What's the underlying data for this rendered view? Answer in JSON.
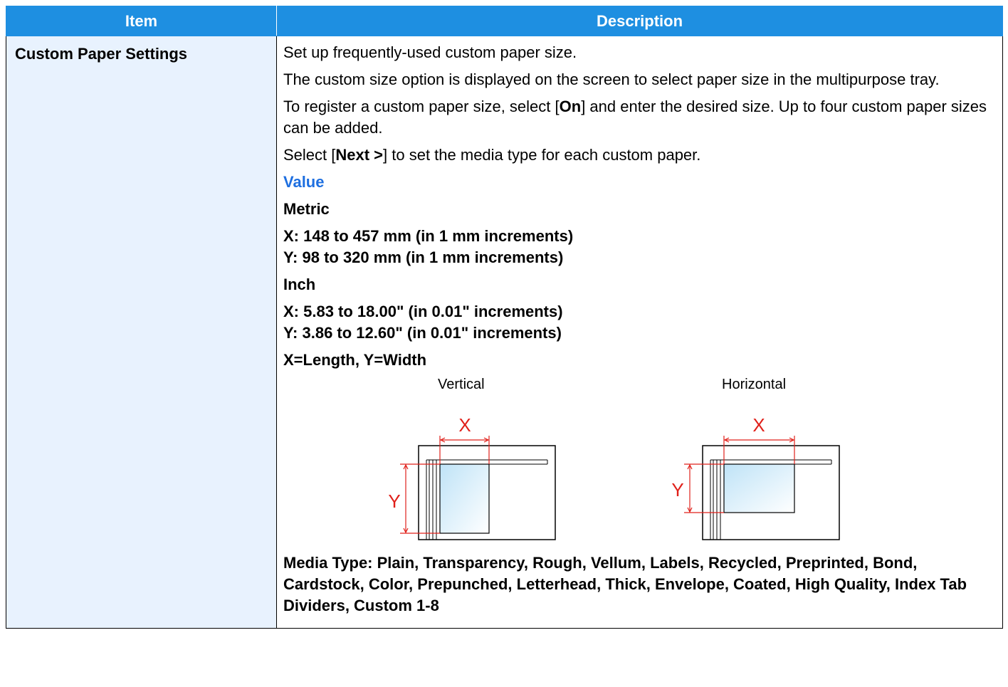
{
  "table": {
    "headers": {
      "item": "Item",
      "description": "Description"
    },
    "row": {
      "item": "Custom Paper Settings",
      "paragraphs": [
        "Set up frequently-used custom paper size.",
        "The custom size option is displayed on the screen to select paper size in the multipurpose tray."
      ],
      "register": {
        "before": "To register a custom paper size, select [",
        "bold": "On",
        "after": "] and enter the desired size. Up to four custom paper sizes can be added."
      },
      "next": {
        "before": "Select [",
        "bold": "Next >",
        "after": "] to set the media type for each custom paper."
      },
      "value_heading": "Value",
      "metric_heading": "Metric",
      "metric_x": "X: 148 to 457 mm (in 1 mm increments)",
      "metric_y": "Y: 98 to 320 mm (in 1 mm increments)",
      "inch_heading": "Inch",
      "inch_x": "X: 5.83 to 18.00\" (in 0.01\" increments)",
      "inch_y": "Y: 3.86 to 12.60\" (in 0.01\" increments)",
      "xy_note": "X=Length, Y=Width",
      "figures": {
        "vertical_label": "Vertical",
        "horizontal_label": "Horizontal",
        "x_marker": "X",
        "y_marker": "Y",
        "dimension_color": "#e0201a"
      },
      "media_type": "Media Type: Plain, Transparency, Rough, Vellum, Labels, Recycled, Preprinted, Bond, Cardstock, Color, Prepunched, Letterhead, Thick, Envelope, Coated, High Quality, Index Tab Dividers, Custom 1-8"
    }
  }
}
